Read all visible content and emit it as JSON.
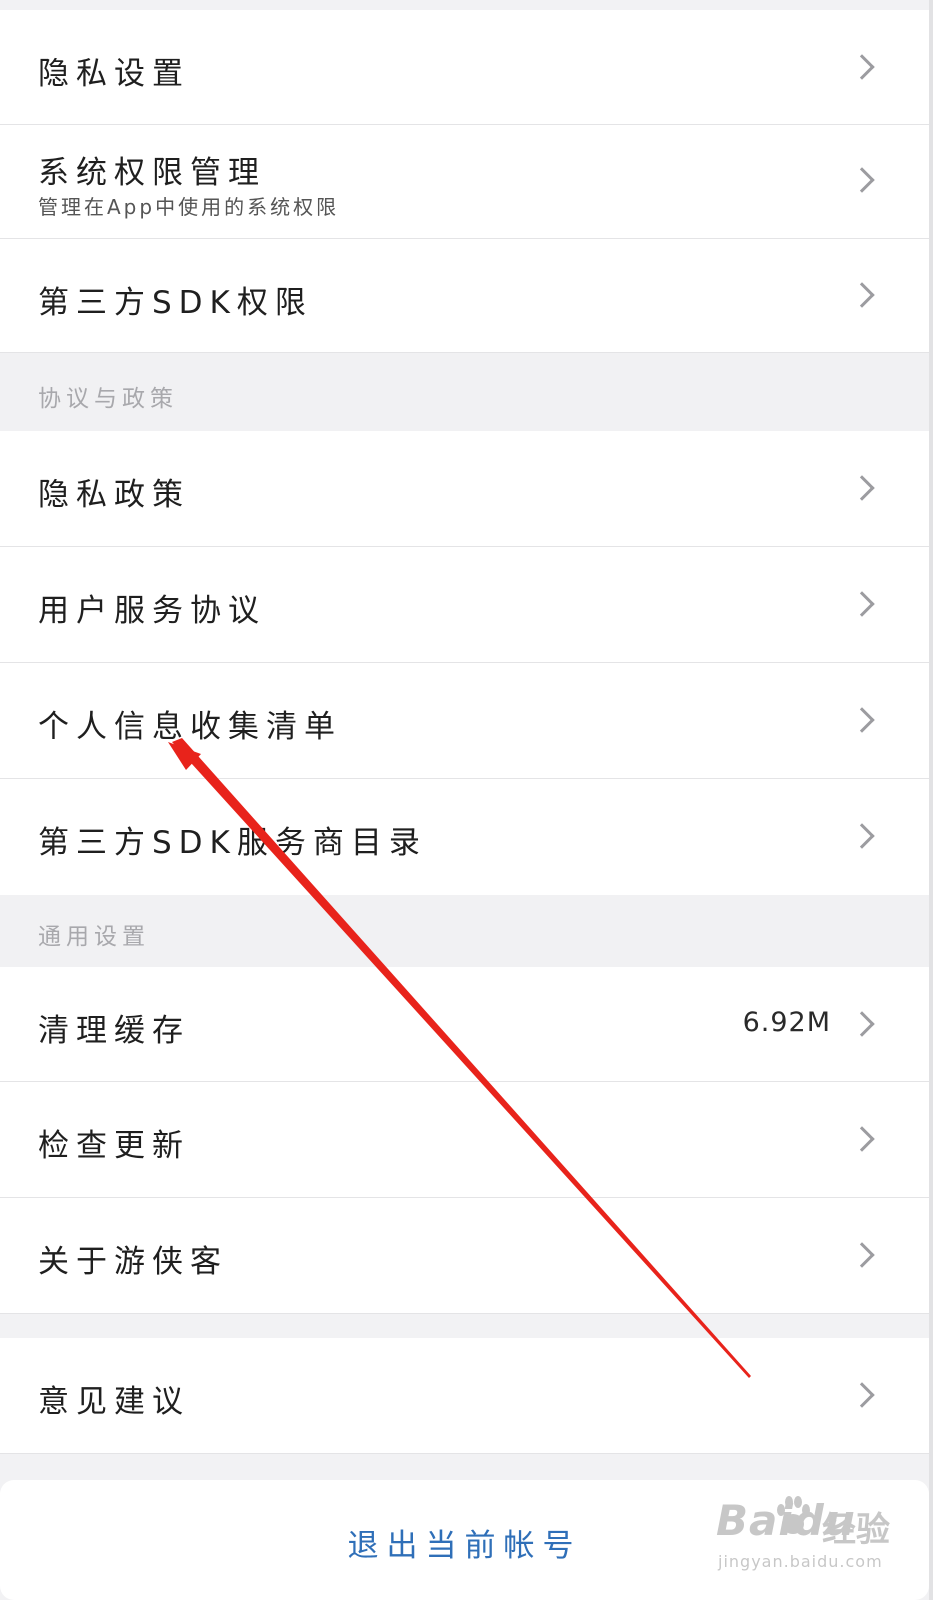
{
  "privacy_section": {
    "items": [
      {
        "label": "隐私设置"
      },
      {
        "label": "系统权限管理",
        "subtitle": "管理在App中使用的系统权限"
      },
      {
        "label": "第三方SDK权限"
      }
    ]
  },
  "policy_section": {
    "title": "协议与政策",
    "items": [
      {
        "label": "隐私政策"
      },
      {
        "label": "用户服务协议"
      },
      {
        "label": "个人信息收集清单"
      },
      {
        "label": "第三方SDK服务商目录"
      }
    ]
  },
  "general_section": {
    "title": "通用设置",
    "items": [
      {
        "label": "清理缓存",
        "value": "6.92M"
      },
      {
        "label": "检查更新"
      },
      {
        "label": "关于游侠客"
      }
    ]
  },
  "feedback_section": {
    "items": [
      {
        "label": "意见建议"
      }
    ]
  },
  "logout": {
    "label": "退出当前帐号"
  },
  "watermark": {
    "brand": "Baidu",
    "brand_cn": "经验",
    "url": "jingyan.baidu.com"
  },
  "annotation": {
    "color": "#e8231b",
    "target": "个人信息收集清单"
  },
  "colors": {
    "background": "#f2f2f4",
    "row_background": "#ffffff",
    "logout_text": "#2f6fb8",
    "section_title": "#a8a8ac"
  }
}
